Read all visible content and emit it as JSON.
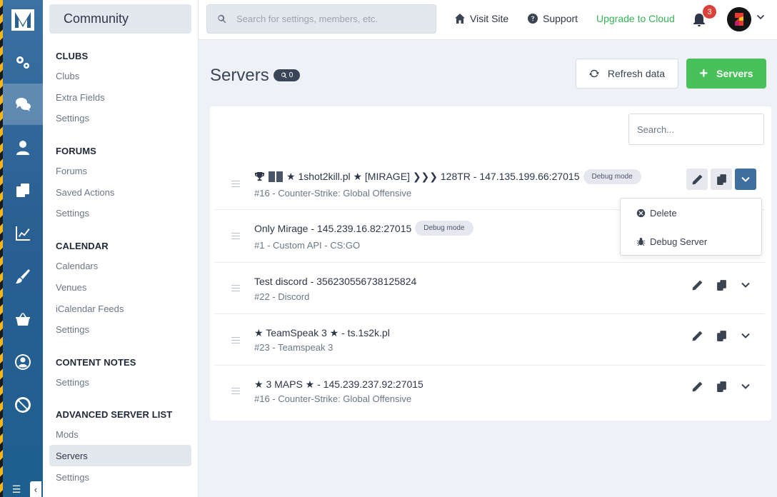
{
  "sidebar": {
    "title": "Community",
    "sections": [
      {
        "heading": "CLUBS",
        "items": [
          "Clubs",
          "Extra Fields",
          "Settings"
        ]
      },
      {
        "heading": "FORUMS",
        "items": [
          "Forums",
          "Saved Actions",
          "Settings"
        ]
      },
      {
        "heading": "CALENDAR",
        "items": [
          "Calendars",
          "Venues",
          "iCalendar Feeds",
          "Settings"
        ]
      },
      {
        "heading": "CONTENT NOTES",
        "items": [
          "Settings"
        ]
      },
      {
        "heading": "ADVANCED SERVER LIST",
        "items": [
          "Mods",
          "Servers",
          "Settings"
        ]
      }
    ]
  },
  "rail": {
    "icons": [
      "logo-icon",
      "cogs-icon",
      "comments-icon",
      "user-icon",
      "copy-icon",
      "chart-line-icon",
      "brush-icon",
      "basket-icon",
      "user-circle-icon",
      "ban-icon"
    ],
    "active": "comments-icon"
  },
  "topbar": {
    "search_placeholder": "Search for settings, members, etc.",
    "visit_site": "Visit Site",
    "support": "Support",
    "upgrade": "Upgrade to Cloud",
    "notifications_count": "3"
  },
  "main": {
    "title": "Servers",
    "count": "0",
    "refresh_label": "Refresh data",
    "add_label": "Servers",
    "table_search_placeholder": "Search..."
  },
  "servers": [
    {
      "title": "★ 1shot2kill.pl ★ [MIRAGE] ❯❯❯ 128TR - 147.135.199.66:27015",
      "subtitle": "#16 - Counter-Strike: Global Offensive",
      "badge": "Debug mode"
    },
    {
      "title": "Only Mirage - 145.239.16.82:27015",
      "subtitle": "#1 - Custom API - CS:GO",
      "badge": "Debug mode"
    },
    {
      "title": "Test discord - 356230556738125824",
      "subtitle": "#22 - Discord",
      "badge": ""
    },
    {
      "title": "★ TeamSpeak 3 ★ - ts.1s2k.pl",
      "subtitle": "#23 - Teamspeak 3",
      "badge": ""
    },
    {
      "title": "★ 3 MAPS ★ - 145.239.237.92:27015",
      "subtitle": "#16 - Counter-Strike: Global Offensive",
      "badge": ""
    }
  ],
  "dropdown": {
    "delete": "Delete",
    "debug": "Debug Server"
  },
  "colors": {
    "accent_green": "#48c15a",
    "upgrade_green": "#38b259",
    "rail_blue": "#2a5f92",
    "active_button_blue": "#3e6f9e",
    "badge_red": "#d9423a"
  }
}
